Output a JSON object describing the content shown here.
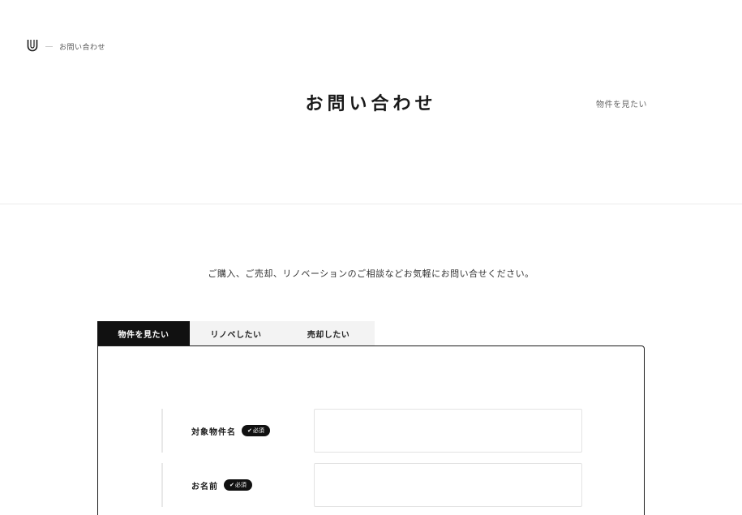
{
  "header": {
    "breadcrumb_label": "お問い合わせ",
    "title": "お問い合わせ",
    "nav_link": "物件を見たい"
  },
  "intro_text": "ご購入、ご売却、リノベーションのご相談などお気軽にお問い合せください。",
  "tabs": [
    {
      "label": "物件を見たい",
      "active": true
    },
    {
      "label": "リノベしたい",
      "active": false
    },
    {
      "label": "売却したい",
      "active": false
    }
  ],
  "form": {
    "required_badge": "必須",
    "fields": [
      {
        "label": "対象物件名",
        "value": "",
        "placeholder": ""
      },
      {
        "label": "お名前",
        "value": "",
        "placeholder": ""
      }
    ]
  },
  "colors": {
    "accent": "#111111",
    "tab_inactive": "#f3f3f3",
    "divider": "#ececec"
  }
}
